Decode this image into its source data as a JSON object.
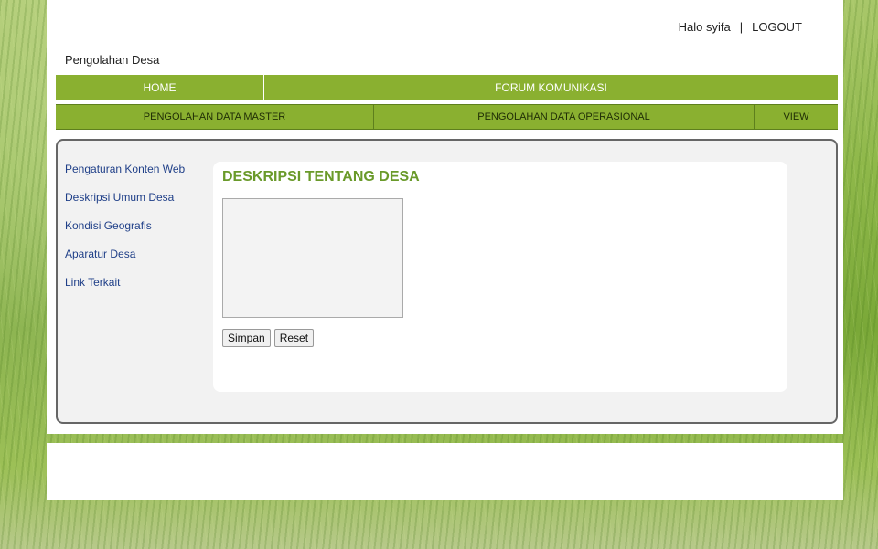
{
  "header": {
    "greeting": "Halo syifa",
    "separator": "|",
    "logout_label": "LOGOUT",
    "brand": "Pengolahan Desa"
  },
  "nav_primary": [
    {
      "label": "HOME"
    },
    {
      "label": "FORUM KOMUNIKASI"
    }
  ],
  "nav_secondary": [
    {
      "label": "PENGOLAHAN DATA MASTER"
    },
    {
      "label": "PENGOLAHAN DATA OPERASIONAL"
    },
    {
      "label": "VIEW"
    }
  ],
  "sidebar": {
    "items": [
      {
        "label": "Pengaturan Konten Web"
      },
      {
        "label": "Deskripsi Umum Desa"
      },
      {
        "label": "Kondisi Geografis"
      },
      {
        "label": "Aparatur Desa"
      },
      {
        "label": "Link Terkait"
      }
    ]
  },
  "main": {
    "title": "DESKRIPSI TENTANG DESA",
    "textarea_value": "",
    "save_label": "Simpan",
    "reset_label": "Reset"
  }
}
